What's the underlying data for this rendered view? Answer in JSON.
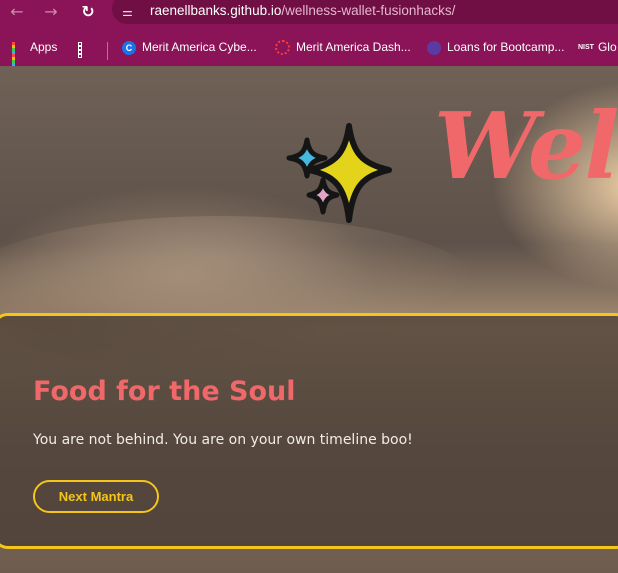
{
  "browser": {
    "url_domain": "raenellbanks.github.io",
    "url_path": "/wellness-wallet-fusionhacks/",
    "bookmarks": [
      {
        "label": "Apps",
        "icon": "apps-grid-icon"
      },
      {
        "label": "",
        "icon": "tiles-icon"
      },
      {
        "label": "Merit America Cybe...",
        "icon": "merit-c-icon"
      },
      {
        "label": "Merit America Dash...",
        "icon": "ring-icon"
      },
      {
        "label": "Loans for Bootcamp...",
        "icon": "globe-icon"
      },
      {
        "label": "Glo",
        "icon": "nist-icon"
      }
    ],
    "nist_text": "NIST"
  },
  "hero": {
    "title": "Wel"
  },
  "card": {
    "title": "Food for the Soul",
    "text": "You are not behind. You are on your own timeline boo!",
    "button_label": "Next Mantra"
  },
  "colors": {
    "chrome": "#8b1357",
    "accent_coral": "#f0686a",
    "accent_yellow": "#f5c518"
  }
}
